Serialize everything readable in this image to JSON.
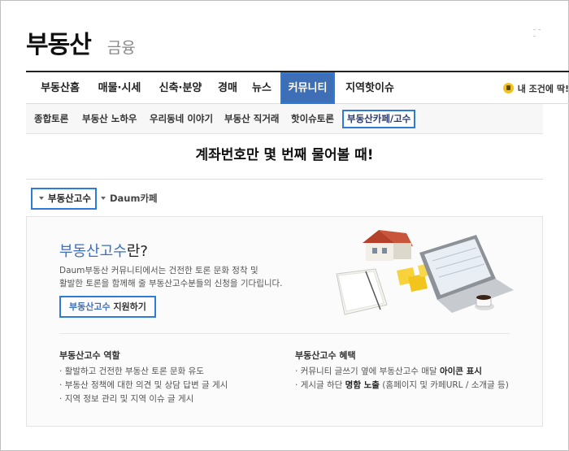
{
  "header": {
    "logo": "부동산",
    "sublogo": "금융"
  },
  "nav": {
    "items": [
      {
        "label": "부동산홈"
      },
      {
        "label": "매물·시세"
      },
      {
        "label": "신축·분양"
      },
      {
        "label": "경매"
      },
      {
        "label": "뉴스"
      },
      {
        "label": "커뮤니티"
      },
      {
        "label": "지역핫이슈"
      }
    ],
    "right_label": "내 조건에 딱!",
    "active_color": "#3e6fb6"
  },
  "subnav": {
    "items": [
      {
        "label": "종합토론"
      },
      {
        "label": "부동산 노하우"
      },
      {
        "label": "우리동네 이야기"
      },
      {
        "label": "부동산 직거래"
      },
      {
        "label": "핫이슈토론"
      },
      {
        "label": "부동산카페/고수"
      }
    ]
  },
  "banner": {
    "text": "계좌번호만 몇 번째 물어볼 때!"
  },
  "tabs": {
    "active": "부동산고수",
    "inactive": "Daum카페"
  },
  "panel": {
    "title_blue": "부동산고수",
    "title_suffix": "란?",
    "desc_line1": "Daum부동산 커뮤니티에서는 건전한 토론 문화 정착 및",
    "desc_line2": "활발한 토론을 함께해 줄 부동산고수분들의 신청을 기다립니다.",
    "apply_blue": "부동산고수",
    "apply_suffix": " 지원하기",
    "role": {
      "title": "부동산고수 역할",
      "items": [
        "활발하고 건전한 부동산 토론 문화 유도",
        "부동산 정책에 대한 의견 및 상담 답변 글 게시",
        "지역 정보 관리 및 지역 이슈 글 게시"
      ]
    },
    "benefit": {
      "title": "부동산고수 혜택",
      "line1_pre": "커뮤니티 글쓰기 옆에 부동산고수 매달 ",
      "line1_bold": "아이콘 표시",
      "line2_pre": "게시글 하단 ",
      "line2_bold": "명함 노출",
      "line2_post": " (홈페이지 및 카페URL / 소개글 등)"
    }
  },
  "colors": {
    "accent": "#2f7bd8",
    "title_blue": "#3b6fc4"
  }
}
